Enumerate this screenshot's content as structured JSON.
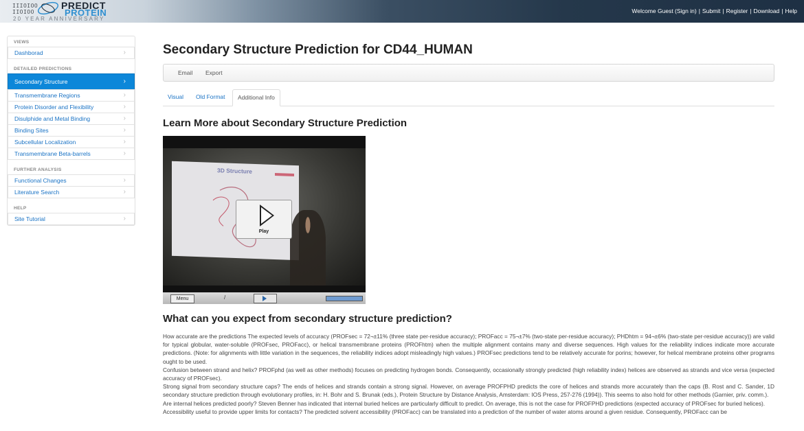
{
  "header": {
    "logo": {
      "bits": "IIIOIOO\nIIOIOO",
      "title_top": "PREDICT",
      "title_bottom": "PROTEIN",
      "tagline": "20 YEAR ANNIVERSARY"
    },
    "welcome": "Welcome Guest (Sign in)",
    "links": [
      "Submit",
      "Register",
      "Download",
      "Help"
    ]
  },
  "sidebar": {
    "sections": [
      {
        "heading": "VIEWS",
        "items": [
          "Dashborad"
        ]
      },
      {
        "heading": "DETAILED PREDICTIONS",
        "items": [
          "Secondary Structure",
          "Transmembrane Regions",
          "Protein Disorder and Flexibility",
          "Disulphide and Metal Binding",
          "Binding Sites",
          "Subcellular Localization",
          "Transmembrane Beta-barrels"
        ]
      },
      {
        "heading": "FURTHER ANALYSIS",
        "items": [
          "Functional Changes",
          "Literature Search"
        ]
      },
      {
        "heading": "HELP",
        "items": [
          "Site Tutorial"
        ]
      }
    ],
    "active": "Secondary Structure"
  },
  "main": {
    "title": "Secondary Structure Prediction for CD44_HUMAN",
    "toolbar": {
      "email": "Email",
      "export": "Export"
    },
    "tabs": [
      {
        "label": "Visual"
      },
      {
        "label": "Old Format"
      },
      {
        "label": "Additional Info"
      }
    ],
    "active_tab": "Additional Info",
    "learn_heading": "Learn More about Secondary Structure Prediction",
    "video": {
      "slide_title": "3D Structure",
      "play_label": "Play",
      "menu_label": "Menu",
      "time_separator": "/"
    },
    "expect_heading": "What can you expect from secondary structure prediction?",
    "paragraphs": [
      "How accurate are the predictions The expected levels of accuracy (PROFsec = 72¬±11% (three state per-residue accuracy); PROFacc = 75¬±7% (two-state per-residue accuracy); PHDhtm = 94¬±6% (two-state per-residue accuracy)) are valid for typical globular, water-soluble (PROFsec, PROFacc), or helical transmembrane proteins (PROFhtm) when the multiple alignment contains many and diverse sequences. High values for the reliability indices indicate more accurate predictions. (Note: for alignments with little variation in the sequences, the reliability indices adopt misleadingly high values.) PROFsec predictions tend to be relatively accurate for porins; however, for helical membrane proteins other programs ought to be used.",
      "Confusion between strand and helix? PROFphd (as well as other methods) focuses on predicting hydrogen bonds. Consequently, occasionally strongly predicted (high reliability index) helices are observed as strands and vice versa (expected accuracy of PROFsec).",
      "Strong signal from secondary structure caps? The ends of helices and strands contain a strong signal. However, on average PROFPHD predicts the core of helices and strands more accurately than the caps (B. Rost and C. Sander, 1D secondary structure prediction through evolutionary profiles, in: H. Bohr and S. Brunak (eds.), Protein Structure by Distance Analysis, Amsterdam: IOS Press, 257-276 (1994)). This seems to also hold for other methods (Garnier, priv. comm.).",
      "Are internal helices predicted poorly? Steven Benner has indicated that internal buried helices are particularly difficult to predict. On average, this is not the case for PROFPHD predictions (expected accuracy of PROFsec for buried helices).",
      "Accessibility useful to provide upper limits for contacts? The predicted solvent accessibility (PROFacc) can be translated into a prediction of the number of water atoms around a given residue. Consequently, PROFacc can be"
    ]
  }
}
